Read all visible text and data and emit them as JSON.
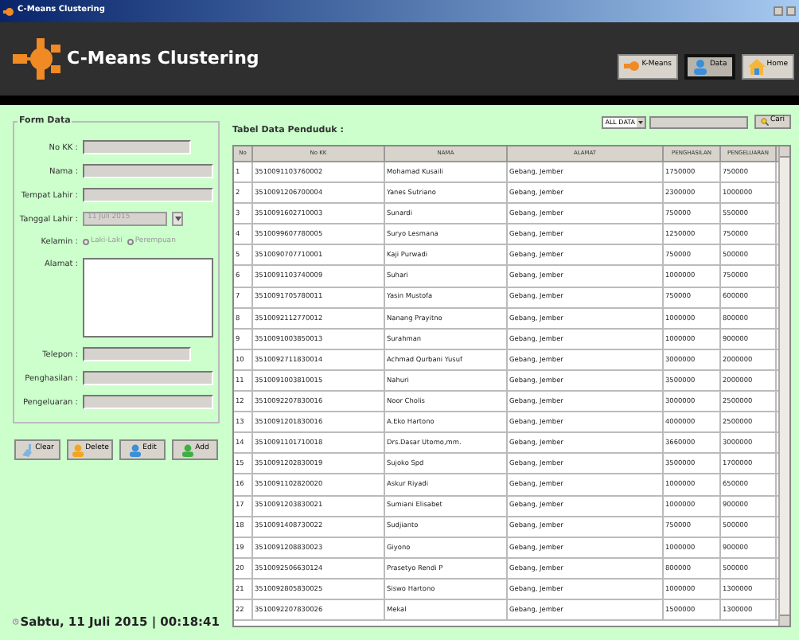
{
  "window": {
    "title": "C-Means Clustering"
  },
  "header": {
    "title": "C-Means Clustering",
    "nav": [
      {
        "label": "K-Means",
        "selected": false,
        "kind": "kmeans"
      },
      {
        "label": "Data",
        "selected": true,
        "kind": "data"
      },
      {
        "label": "Home",
        "selected": false,
        "kind": "home"
      }
    ]
  },
  "form": {
    "title": "Form Data",
    "fields": [
      {
        "label": "No KK :",
        "kind": "short"
      },
      {
        "label": "Nama :",
        "kind": "text"
      },
      {
        "label": "Tempat Lahir :",
        "kind": "text"
      },
      {
        "label": "Tanggal Lahir :",
        "kind": "date",
        "value": "11 Juli 2015",
        "disabled": true
      },
      {
        "label": "Kelamin :",
        "kind": "radio",
        "disabled": true,
        "options": [
          {
            "label": "Laki-Laki",
            "selected": false
          },
          {
            "label": "Perempuan",
            "selected": false
          }
        ]
      },
      {
        "label": "Alamat :",
        "kind": "textarea"
      },
      {
        "label": "Telepon :",
        "kind": "short"
      },
      {
        "label": "Penghasilan :",
        "kind": "text"
      },
      {
        "label": "Pengeluaran :",
        "kind": "text"
      }
    ],
    "buttons": [
      {
        "label": "Clear",
        "kind": "clear"
      },
      {
        "label": "Delete",
        "kind": "delete"
      },
      {
        "label": "Edit",
        "kind": "edit"
      },
      {
        "label": "Add",
        "kind": "add"
      }
    ]
  },
  "table": {
    "title": "Tabel Data Penduduk :",
    "filter": "ALL DATA",
    "search_button": "Cari",
    "columns": [
      "No",
      "No KK",
      "NAMA",
      "ALAMAT",
      "PENGHASILAN",
      "PENGELUARAN"
    ],
    "rows": [
      [
        "1",
        "3510091103760002",
        "Mohamad Kusaili",
        "Gebang, Jember",
        "1750000",
        "750000"
      ],
      [
        "2",
        "3510091206700004",
        "Yanes Sutriano",
        "Gebang, Jember",
        "2300000",
        "1000000"
      ],
      [
        "3",
        "3510091602710003",
        "Sunardi",
        "Gebang, Jember",
        "750000",
        "550000"
      ],
      [
        "4",
        "3510099607780005",
        "Suryo Lesmana",
        "Gebang, Jember",
        "1250000",
        "750000"
      ],
      [
        "5",
        "3510090707710001",
        "Kaji Purwadi",
        "Gebang, Jember",
        "750000",
        "500000"
      ],
      [
        "6",
        "3510091103740009",
        "Suhari",
        "Gebang, Jember",
        "1000000",
        "750000"
      ],
      [
        "7",
        "3510091705780011",
        "Yasin Mustofa",
        "Gebang, Jember",
        "750000",
        "600000"
      ],
      [
        "8",
        "3510092112770012",
        "Nanang Prayitno",
        "Gebang, Jember",
        "1000000",
        "800000"
      ],
      [
        "9",
        "3510091003850013",
        "Surahman",
        "Gebang, Jember",
        "1000000",
        "900000"
      ],
      [
        "10",
        "3510092711830014",
        "Achmad Qurbani Yusuf",
        "Gebang, Jember",
        "3000000",
        "2000000"
      ],
      [
        "11",
        "3510091003810015",
        "Nahuri",
        "Gebang, Jember",
        "3500000",
        "2000000"
      ],
      [
        "12",
        "3510092207830016",
        "Noor Cholis",
        "Gebang, Jember",
        "3000000",
        "2500000"
      ],
      [
        "13",
        "3510091201830016",
        "A.Eko Hartono",
        "Gebang, Jember",
        "4000000",
        "2500000"
      ],
      [
        "14",
        "3510091101710018",
        "Drs.Dasar Utomo,mm.",
        "Gebang, Jember",
        "3660000",
        "3000000"
      ],
      [
        "15",
        "3510091202830019",
        "Sujoko Spd",
        "Gebang, Jember",
        "3500000",
        "1700000"
      ],
      [
        "16",
        "3510091102820020",
        "Askur Riyadi",
        "Gebang, Jember",
        "1000000",
        "650000"
      ],
      [
        "17",
        "3510091203830021",
        "Sumiani Elisabet",
        "Gebang, Jember",
        "1000000",
        "900000"
      ],
      [
        "18",
        "3510091408730022",
        "Sudjianto",
        "Gebang, Jember",
        "750000",
        "500000"
      ],
      [
        "19",
        "3510091208830023",
        "Giyono",
        "Gebang, Jember",
        "1000000",
        "900000"
      ],
      [
        "20",
        "3510092506630124",
        "Prasetyo Rendi P",
        "Gebang, Jember",
        "800000",
        "500000"
      ],
      [
        "21",
        "3510092805830025",
        "Siswo Hartono",
        "Gebang, Jember",
        "1000000",
        "1300000"
      ],
      [
        "22",
        "3510092207830026",
        "Mekal",
        "Gebang, Jember",
        "1500000",
        "1300000"
      ]
    ]
  },
  "status_bar": {
    "datetime": "Sabtu, 11 Juli 2015 | 00:18:41"
  }
}
